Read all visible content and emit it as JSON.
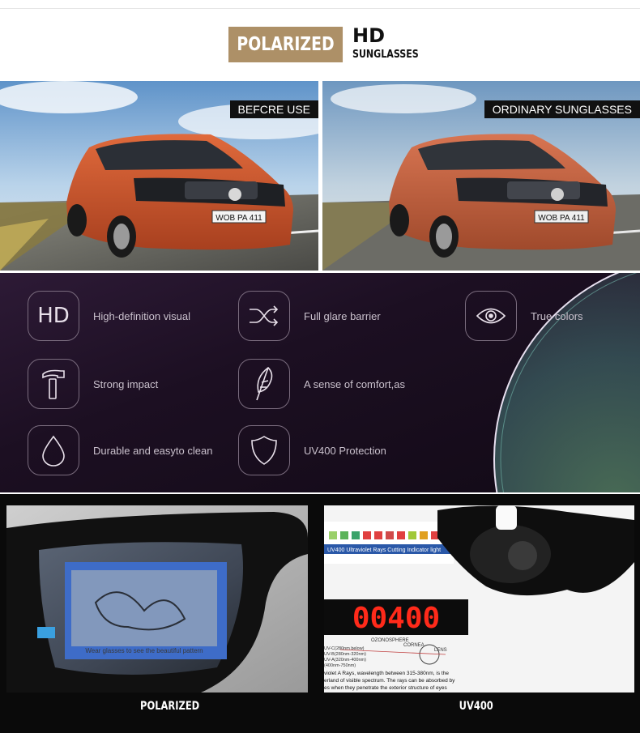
{
  "header": {
    "badge": "POLARIZED",
    "title": "HD",
    "subtitle": "SUNGLASSES"
  },
  "comparison": {
    "left_label": "BEFCRE USE",
    "right_label": "ORDINARY SUNGLASSES",
    "plate_text": "WOB PA 411"
  },
  "features": [
    {
      "icon": "hd-icon",
      "icon_text": "HD",
      "label": "High-definition visual"
    },
    {
      "icon": "shuffle-icon",
      "label": "Full glare barrier"
    },
    {
      "icon": "eye-icon",
      "label": "True colors"
    },
    {
      "icon": "hammer-icon",
      "label": "Strong impact"
    },
    {
      "icon": "feather-icon",
      "label": "A sense of comfort,as"
    },
    {
      "icon": "water-drop-icon",
      "label": "Durable and easyto clean"
    },
    {
      "icon": "shield-icon",
      "label": "UV400 Protection"
    }
  ],
  "demo": {
    "left_label": "POLARIZED",
    "right_label": "UV400",
    "lens_text": "Wear glasses to see the beautiful pattern",
    "meter_reading": "00400",
    "card_heading": "UV400 Ultraviolet Rays Cutting Indicator light",
    "ozonosphere": "OZONOSPHERE",
    "cornea": "CORNEA",
    "lens": "LENS",
    "uv_lines": [
      "UV-C(280nm below)",
      "UV-B(280nm-320nm)",
      "UV-A(320nm-400nm)",
      "(400nm-750nm)"
    ],
    "caption_1": "violet A Rays, wavelength between 315-380nm, is the",
    "caption_2": "erland of visible spectrum. The rays can be absorbed by",
    "caption_3": "es when they penetrate the exterior structure of eyes"
  },
  "colors": {
    "badge": "#ad9067",
    "car_body": "#c8552f",
    "panel_dark": "#0a0a0a",
    "feature_bg": "#1c0f22",
    "meter_digits": "#ff2a1a"
  }
}
